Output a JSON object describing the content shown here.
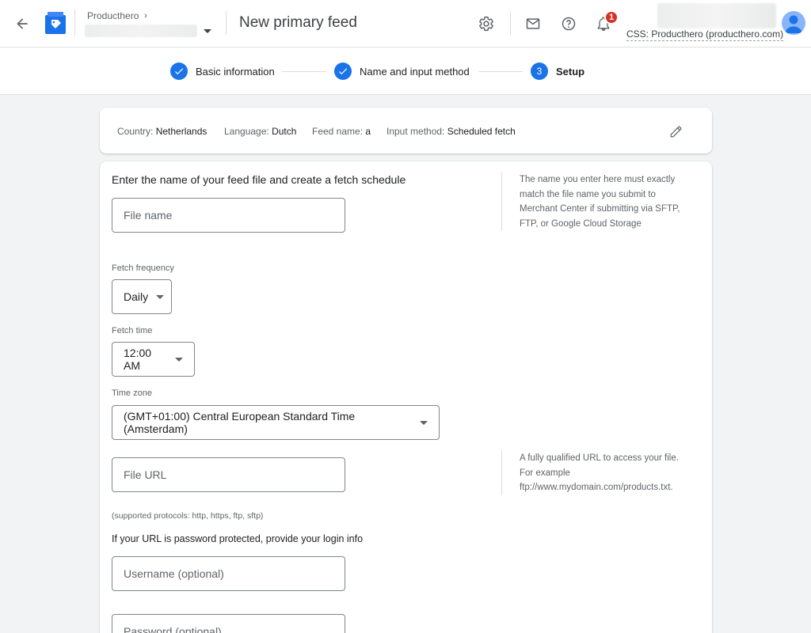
{
  "header": {
    "account_name": "Producthero",
    "page_title": "New primary feed",
    "notification_count": "1",
    "css_label": "CSS: Producthero (producthero.com)"
  },
  "stepper": {
    "steps": [
      {
        "label": "Basic information",
        "state": "done"
      },
      {
        "label": "Name and input method",
        "state": "done"
      },
      {
        "number": "3",
        "label": "Setup",
        "state": "active"
      }
    ]
  },
  "summary": {
    "country_label": "Country:",
    "country_value": "Netherlands",
    "language_label": "Language:",
    "language_value": "Dutch",
    "feedname_label": "Feed name:",
    "feedname_value": "a",
    "method_label": "Input method:",
    "method_value": "Scheduled fetch"
  },
  "form": {
    "heading": "Enter the name of your feed file and create a fetch schedule",
    "file_name_placeholder": "File name",
    "file_name_help": "The name you enter here must exactly match the file name you submit to Merchant Center if submitting via SFTP, FTP, or Google Cloud Storage",
    "fetch_frequency_label": "Fetch frequency",
    "fetch_frequency_value": "Daily",
    "fetch_time_label": "Fetch time",
    "fetch_time_value": "12:00 AM",
    "time_zone_label": "Time zone",
    "time_zone_value": "(GMT+01:00) Central European Standard Time (Amsterdam)",
    "file_url_placeholder": "File URL",
    "file_url_help_1": "A fully qualified URL to access your file.",
    "file_url_help_2": "For example",
    "file_url_help_3": "ftp://www.mydomain.com/products.txt.",
    "protocols_note": "(supported protocols: http, https, ftp, sftp)",
    "login_heading": "If your URL is password protected, provide your login info",
    "username_placeholder": "Username (optional)",
    "password_placeholder": "Password (optional)"
  },
  "colors": {
    "accent": "#1a73e8",
    "badge": "#d93025",
    "background": "#f1f3f4"
  }
}
